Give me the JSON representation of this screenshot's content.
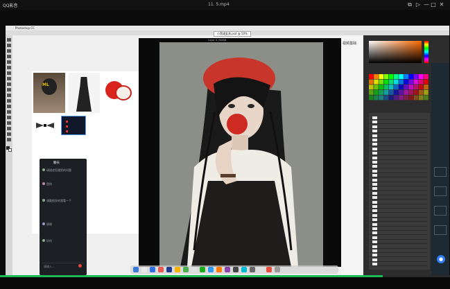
{
  "player": {
    "app_title": "QQ影音",
    "file_title": "11. 5.mp4"
  },
  "photoshop": {
    "menu_text": "Photoshop CC",
    "doc_tab": "小黑裙女孩.psd @ 50%",
    "canvas_title": "Layer 0, RGB/8",
    "side_text": "视频基础"
  },
  "reference": {
    "photo_text": "ML"
  },
  "chat": {
    "title": "聊天",
    "messages": [
      {
        "name": "",
        "text": "请描述您遇到的问题"
      },
      {
        "name": "",
        "text": "是的"
      },
      {
        "name": "",
        "text": "请截图发给我看一下"
      },
      {
        "name": "",
        "text": "谢谢"
      },
      {
        "name": "",
        "text": "好的"
      }
    ],
    "input_placeholder": "请输入..."
  },
  "colors": {
    "progress": "#1db954",
    "canvas_bg": "#8b8f88",
    "panel_bg": "#2d2d2d"
  },
  "progress": {
    "fraction": 0.85
  }
}
